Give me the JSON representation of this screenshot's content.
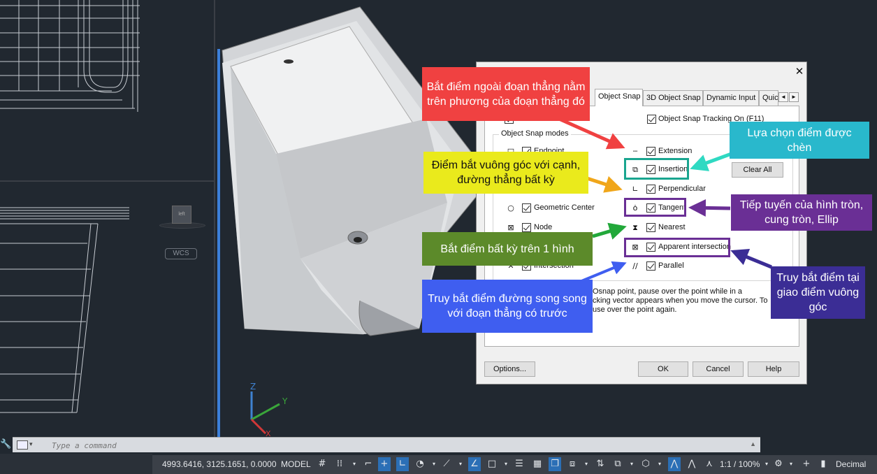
{
  "dialog": {
    "close_glyph": "✕",
    "tabs": [
      {
        "label": "Object Snap",
        "active": true
      },
      {
        "label": "3D Object Snap",
        "active": false
      },
      {
        "label": "Dynamic Input",
        "active": false
      },
      {
        "label": "Quic",
        "active": false
      }
    ],
    "tab_scroll_left": "◄",
    "tab_scroll_right": "►",
    "tracking_label": "Object Snap Tracking On (F11)",
    "modes_legend": "Object Snap modes",
    "left_modes": [
      {
        "label": "Endpoint",
        "checked": true
      },
      {
        "label": "Geometric Center",
        "checked": true
      },
      {
        "label": "Node",
        "checked": true
      },
      {
        "label": "Intersection",
        "checked": true
      }
    ],
    "right_modes": [
      {
        "label": "Extension",
        "checked": true
      },
      {
        "label": "Insertion",
        "checked": true
      },
      {
        "label": "Perpendicular",
        "checked": true
      },
      {
        "label": "Tangent",
        "checked": true
      },
      {
        "label": "Nearest",
        "checked": true
      },
      {
        "label": "Apparent intersection",
        "checked": true
      },
      {
        "label": "Parallel",
        "checked": true
      }
    ],
    "clear_all_label": "Clear All",
    "help_text_1": "Osnap point, pause over the point while in a",
    "help_text_2": "cking vector appears when you move the cursor.  To",
    "help_text_3": "use over the point again.",
    "options_label": "Options...",
    "ok_label": "OK",
    "cancel_label": "Cancel",
    "help_label": "Help"
  },
  "callouts": {
    "extension": "Bắt điểm ngoài đoạn thẳng nằm trên phương của đoạn thẳng đó",
    "insertion": "Lựa chọn điểm được chèn",
    "perpendicular": "Điểm bắt vuông góc với cạnh, đường thẳng bất kỳ",
    "tangent": "Tiếp tuyến của hình tròn, cung tròn, Ellip",
    "nearest": "Bắt điểm bất kỳ trên 1 hình",
    "parallel": "Truy bắt điểm đường song song với đoạn thẳng có trước",
    "apparent": "Truy bắt điểm tại giao điểm vuông góc"
  },
  "colors": {
    "extension": "#f04141",
    "insertion": "#29b8cc",
    "perpendicular": "#eaea1c",
    "tangent": "#6a2f95",
    "nearest": "#5c8a2a",
    "parallel": "#3f5ef0",
    "apparent": "#3b2d95",
    "insertion_box": "#1aa58f",
    "purple_box": "#6a2f95"
  },
  "viewport": {
    "wcs_label": "WCS",
    "viewcube_label": "left",
    "axis_z": "Z",
    "axis_y": "Y",
    "axis_x": "X"
  },
  "command": {
    "placeholder": "Type a command"
  },
  "status": {
    "coords": "4993.6416, 3125.1651, 0.0000",
    "model_tab": "MODEL",
    "zoom": "1:1 / 100%",
    "units": "Decimal"
  }
}
